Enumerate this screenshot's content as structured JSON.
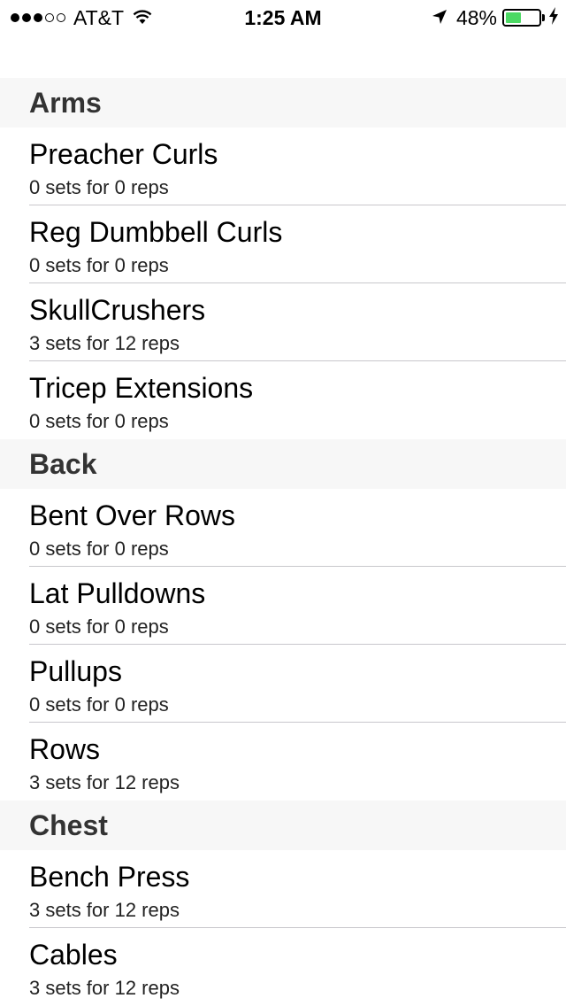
{
  "status_bar": {
    "signal_full": 3,
    "signal_empty": 2,
    "carrier": "AT&T",
    "time": "1:25 AM",
    "battery_percent": "48%",
    "battery_level": 0.48,
    "battery_color": "#4cd964"
  },
  "sections": [
    {
      "title": "Arms",
      "items": [
        {
          "name": "Preacher Curls",
          "detail": "0 sets for 0 reps"
        },
        {
          "name": "Reg Dumbbell Curls",
          "detail": "0 sets for 0 reps"
        },
        {
          "name": "SkullCrushers",
          "detail": "3 sets for 12 reps"
        },
        {
          "name": "Tricep Extensions",
          "detail": "0 sets for 0 reps"
        }
      ]
    },
    {
      "title": "Back",
      "items": [
        {
          "name": "Bent Over Rows",
          "detail": "0 sets for 0 reps"
        },
        {
          "name": "Lat Pulldowns",
          "detail": "0 sets for 0 reps"
        },
        {
          "name": "Pullups",
          "detail": "0 sets for 0 reps"
        },
        {
          "name": "Rows",
          "detail": "3 sets for 12 reps"
        }
      ]
    },
    {
      "title": "Chest",
      "items": [
        {
          "name": "Bench Press",
          "detail": "3 sets for 12 reps"
        },
        {
          "name": "Cables",
          "detail": "3 sets for 12 reps"
        }
      ]
    }
  ]
}
